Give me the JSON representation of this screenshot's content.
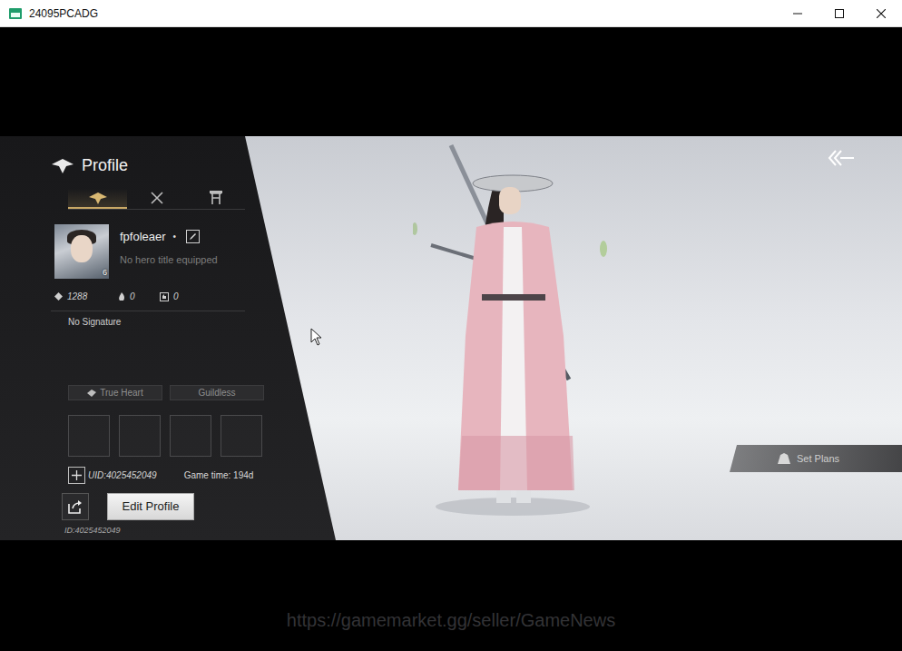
{
  "window": {
    "title": "24095PCADG"
  },
  "profile": {
    "title": "Profile",
    "tabs": [
      {
        "selected": true
      },
      {
        "selected": false
      },
      {
        "selected": false
      }
    ]
  },
  "player": {
    "name": "fpfoleaer",
    "status_dot": "•",
    "level": "6",
    "hero_title": "No hero title equipped",
    "stats": [
      "1288",
      "0",
      "0"
    ],
    "signature": "No Signature",
    "tags": [
      "True Heart",
      "Guildless"
    ],
    "slots": [
      {
        "filled": false
      },
      {
        "filled": false
      },
      {
        "filled": false
      },
      {
        "filled": false
      }
    ],
    "uid": "UID:4025452049",
    "game_time": "Game time: 194d",
    "id": "ID:4025452049"
  },
  "buttons": {
    "edit_profile": "Edit Profile",
    "set_plans": "Set Plans"
  },
  "watermark": "https://gamemarket.gg/seller/GameNews"
}
